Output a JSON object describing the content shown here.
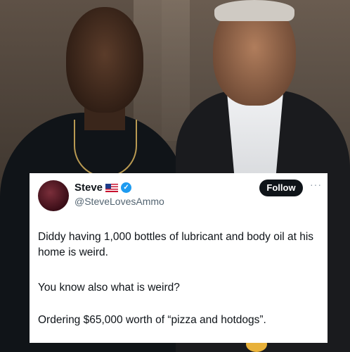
{
  "tweet": {
    "display_name": "Steve",
    "handle": "@SteveLovesAmmo",
    "follow_label": "Follow",
    "more_label": "···",
    "verified_mark": "✓",
    "paragraphs": [
      "Diddy having 1,000 bottles of lubricant and body oil at his home is weird.",
      "You know also what is weird?",
      "Ordering $65,000 worth of “pizza and hotdogs”."
    ]
  },
  "colors": {
    "card_background": "#ffffff",
    "text": "#0f1419",
    "secondary_text": "#536471",
    "verified_badge": "#1d9bf0",
    "follow_button": "#0f1419"
  }
}
